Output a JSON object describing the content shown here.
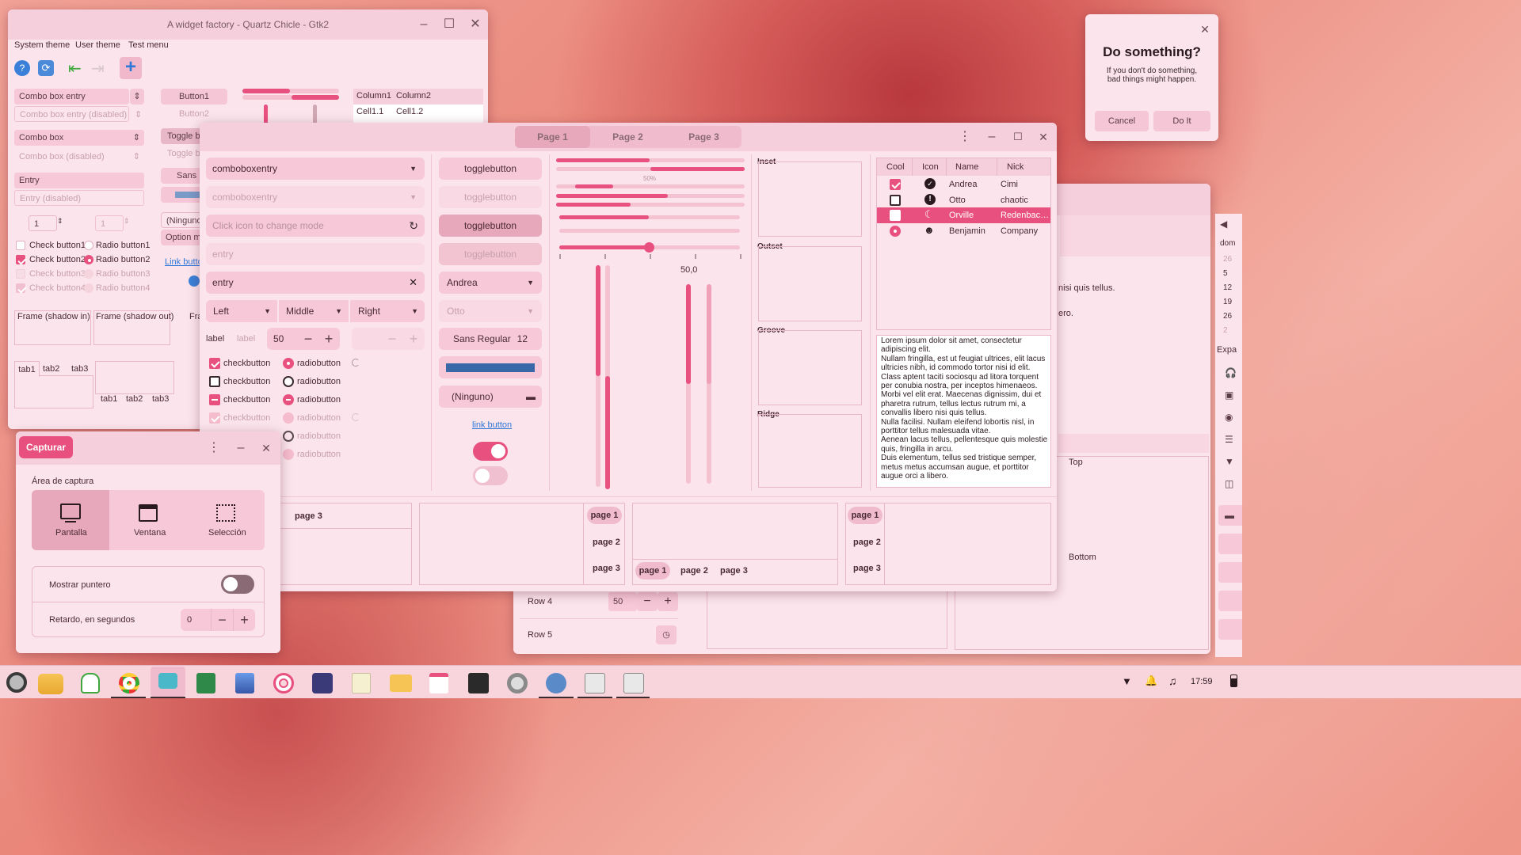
{
  "widget_factory": {
    "title": "A widget factory - Quartz Chicle - Gtk2",
    "menu": [
      "System theme",
      "User theme",
      "Test menu"
    ],
    "combo_entry": "Combo box entry",
    "combo_entry_dis": "Combo box entry (disabled)",
    "combo_box": "Combo box",
    "combo_box_dis": "Combo box (disabled)",
    "entry": "Entry",
    "entry_dis": "Entry (disabled)",
    "spin1": "1",
    "spin2": "1",
    "checks": [
      {
        "label": "Check button1",
        "checked": false,
        "disabled": false
      },
      {
        "label": "Check button2",
        "checked": true,
        "disabled": false
      },
      {
        "label": "Check button3",
        "checked": false,
        "disabled": true
      },
      {
        "label": "Check button4",
        "checked": true,
        "disabled": true
      }
    ],
    "radios": [
      {
        "label": "Radio button1",
        "disabled": false
      },
      {
        "label": "Radio button2",
        "disabled": false
      },
      {
        "label": "Radio button3",
        "disabled": true
      },
      {
        "label": "Radio button4",
        "disabled": true
      }
    ],
    "button1": "Button1",
    "button2": "Button2",
    "toggle": "Toggle bu",
    "toggle_dis": "Toggle bu",
    "font_btn": "Sans",
    "ninguno": "(Ninguno",
    "option_menu": "Option me",
    "link": "Link butto",
    "col1": "Column1",
    "col2": "Column2",
    "cell11": "Cell1.1",
    "cell12": "Cell1.2",
    "frame_in": "Frame (shadow in)",
    "frame_out": "Frame (shadow out)",
    "frame_cut": "Fra",
    "tabs": [
      "tab1",
      "tab2",
      "tab3"
    ]
  },
  "dialog": {
    "title": "Do something?",
    "message": "If you don't do something,\nbad things might happen.",
    "cancel": "Cancel",
    "ok": "Do It"
  },
  "gtk4": {
    "pages": [
      "Page 1",
      "Page 2",
      "Page 3"
    ],
    "combo1": "comboboxentry",
    "combo2": "comboboxentry",
    "mode_placeholder": "Click icon to change mode",
    "entry_placeholder": "entry",
    "entry_value": "entry",
    "dropdowns": [
      "Left",
      "Middle",
      "Right"
    ],
    "label1": "label",
    "label2": "label",
    "spin_value": "50",
    "checkbutton": "checkbutton",
    "radiobutton": "radiobutton",
    "togglebutton": "togglebutton",
    "combo_andrea": "Andrea",
    "combo_otto": "Otto",
    "font_name": "Sans Regular",
    "font_size": "12",
    "file_none": "(Ninguno)",
    "link": "link button",
    "switch1_on": true,
    "switch2_on": false,
    "progress_label": "50%",
    "scale_value": "50,0",
    "frames": [
      "Inset",
      "Outset",
      "Groove",
      "Ridge"
    ],
    "tree_headers": [
      "Cool",
      "Icon",
      "Name",
      "Nick"
    ],
    "tree_rows": [
      {
        "name": "Andrea",
        "nick": "Cimi",
        "cool": "check",
        "icon": "check-circle-icon"
      },
      {
        "name": "Otto",
        "nick": "chaotic",
        "cool": "empty",
        "icon": "warning-icon"
      },
      {
        "name": "Orville",
        "nick": "Redenbac…",
        "cool": "check",
        "icon": "moon-icon",
        "selected": true
      },
      {
        "name": "Benjamin",
        "nick": "Company",
        "cool": "radio",
        "icon": "emoji-icon"
      }
    ],
    "lorem": "Lorem ipsum dolor sit amet, consectetur adipiscing elit.\nNullam fringilla, est ut feugiat ultrices, elit lacus ultricies nibh, id commodo tortor nisi id elit.\nClass aptent taciti sociosqu ad litora torquent per conubia nostra, per inceptos himenaeos.\nMorbi vel elit erat. Maecenas dignissim, dui et pharetra rutrum, tellus lectus rutrum mi, a convallis libero nisi quis tellus.\nNulla facilisi. Nullam eleifend lobortis nisl, in porttitor tellus malesuada vitae.\nAenean lacus tellus, pellentesque quis molestie quis, fringilla in arcu.\nDuis elementum, tellus sed tristique semper, metus metus accumsan augue, et porttitor augue orci a libero.",
    "nb_pages": [
      "page 1",
      "page 2",
      "page 3"
    ]
  },
  "back_window": {
    "row4": "Row 4",
    "row4_value": "50",
    "row5": "Row 5",
    "top": "Top",
    "bottom": "Bottom",
    "text1": "nisi quis tellus.",
    "text2": "ero.",
    "side_header": "dom",
    "dates": [
      "26",
      "5",
      "12",
      "19",
      "26",
      "2"
    ],
    "expander": "Expa"
  },
  "capture": {
    "title": "Capturar",
    "area_label": "Área de captura",
    "modes": [
      "Pantalla",
      "Ventana",
      "Selección"
    ],
    "pointer": "Mostrar puntero",
    "delay": "Retardo, en segundos",
    "delay_value": "0"
  },
  "taskbar": {
    "time": "17:59"
  },
  "colors": {
    "accent": "#e8507f",
    "surface": "#fbe4ec",
    "header": "#f5cfdc"
  }
}
